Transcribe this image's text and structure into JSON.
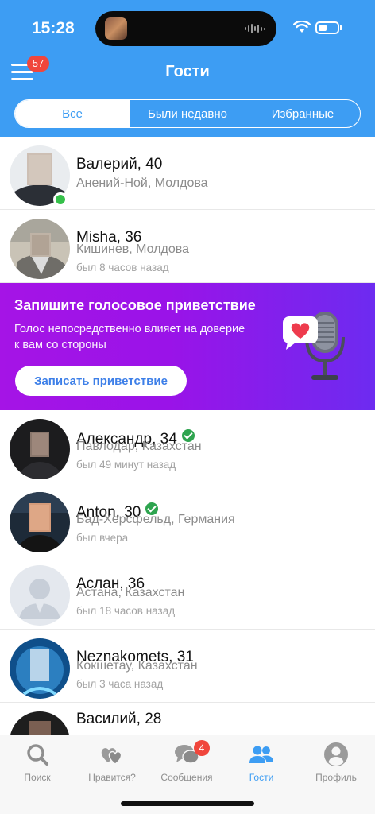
{
  "status_bar": {
    "time": "15:28"
  },
  "header": {
    "title": "Гости",
    "menu_badge": "57",
    "segments": [
      {
        "label": "Все",
        "active": true
      },
      {
        "label": "Были недавно",
        "active": false
      },
      {
        "label": "Избранные",
        "active": false
      }
    ]
  },
  "guests_top": [
    {
      "name": "Валерий, 40",
      "location": "Анений-Ной, Молдова",
      "seen": "",
      "online": true,
      "verified": false
    },
    {
      "name": "Misha, 36",
      "location": "Кишинев, Молдова",
      "seen": "был 8 часов назад",
      "online": false,
      "verified": false
    }
  ],
  "promo": {
    "title": "Запишите голосовое приветствие",
    "text": "Голос непосредственно влияет на доверие к вам со стороны",
    "button": "Записать приветствие"
  },
  "guests_bottom": [
    {
      "name": "Александр, 34",
      "location": "Павлодар, Казахстан",
      "seen": "был 49 минут назад",
      "verified": true
    },
    {
      "name": "Anton, 30",
      "location": "Бад-Херсфельд, Германия",
      "seen": "был вчера",
      "verified": true
    },
    {
      "name": "Аслан, 36",
      "location": "Астана, Казахстан",
      "seen": "был 18 часов назад",
      "verified": false
    },
    {
      "name": "Neznakomets, 31",
      "location": "Кокшетау, Казахстан",
      "seen": "был 3 часа назад",
      "verified": false
    },
    {
      "name": "Василий, 28",
      "location": "",
      "seen": "",
      "verified": false
    }
  ],
  "tabbar": [
    {
      "label": "Поиск",
      "icon": "search-icon"
    },
    {
      "label": "Нравится?",
      "icon": "hearts-icon"
    },
    {
      "label": "Сообщения",
      "icon": "chat-icon",
      "badge": "4"
    },
    {
      "label": "Гости",
      "icon": "guests-icon",
      "active": true
    },
    {
      "label": "Профиль",
      "icon": "profile-icon"
    }
  ],
  "colors": {
    "accent": "#3d9df3",
    "promo_start": "#a514e6",
    "promo_end": "#6d2bf0",
    "badge": "#f0463c",
    "verified": "#2ea44f"
  }
}
